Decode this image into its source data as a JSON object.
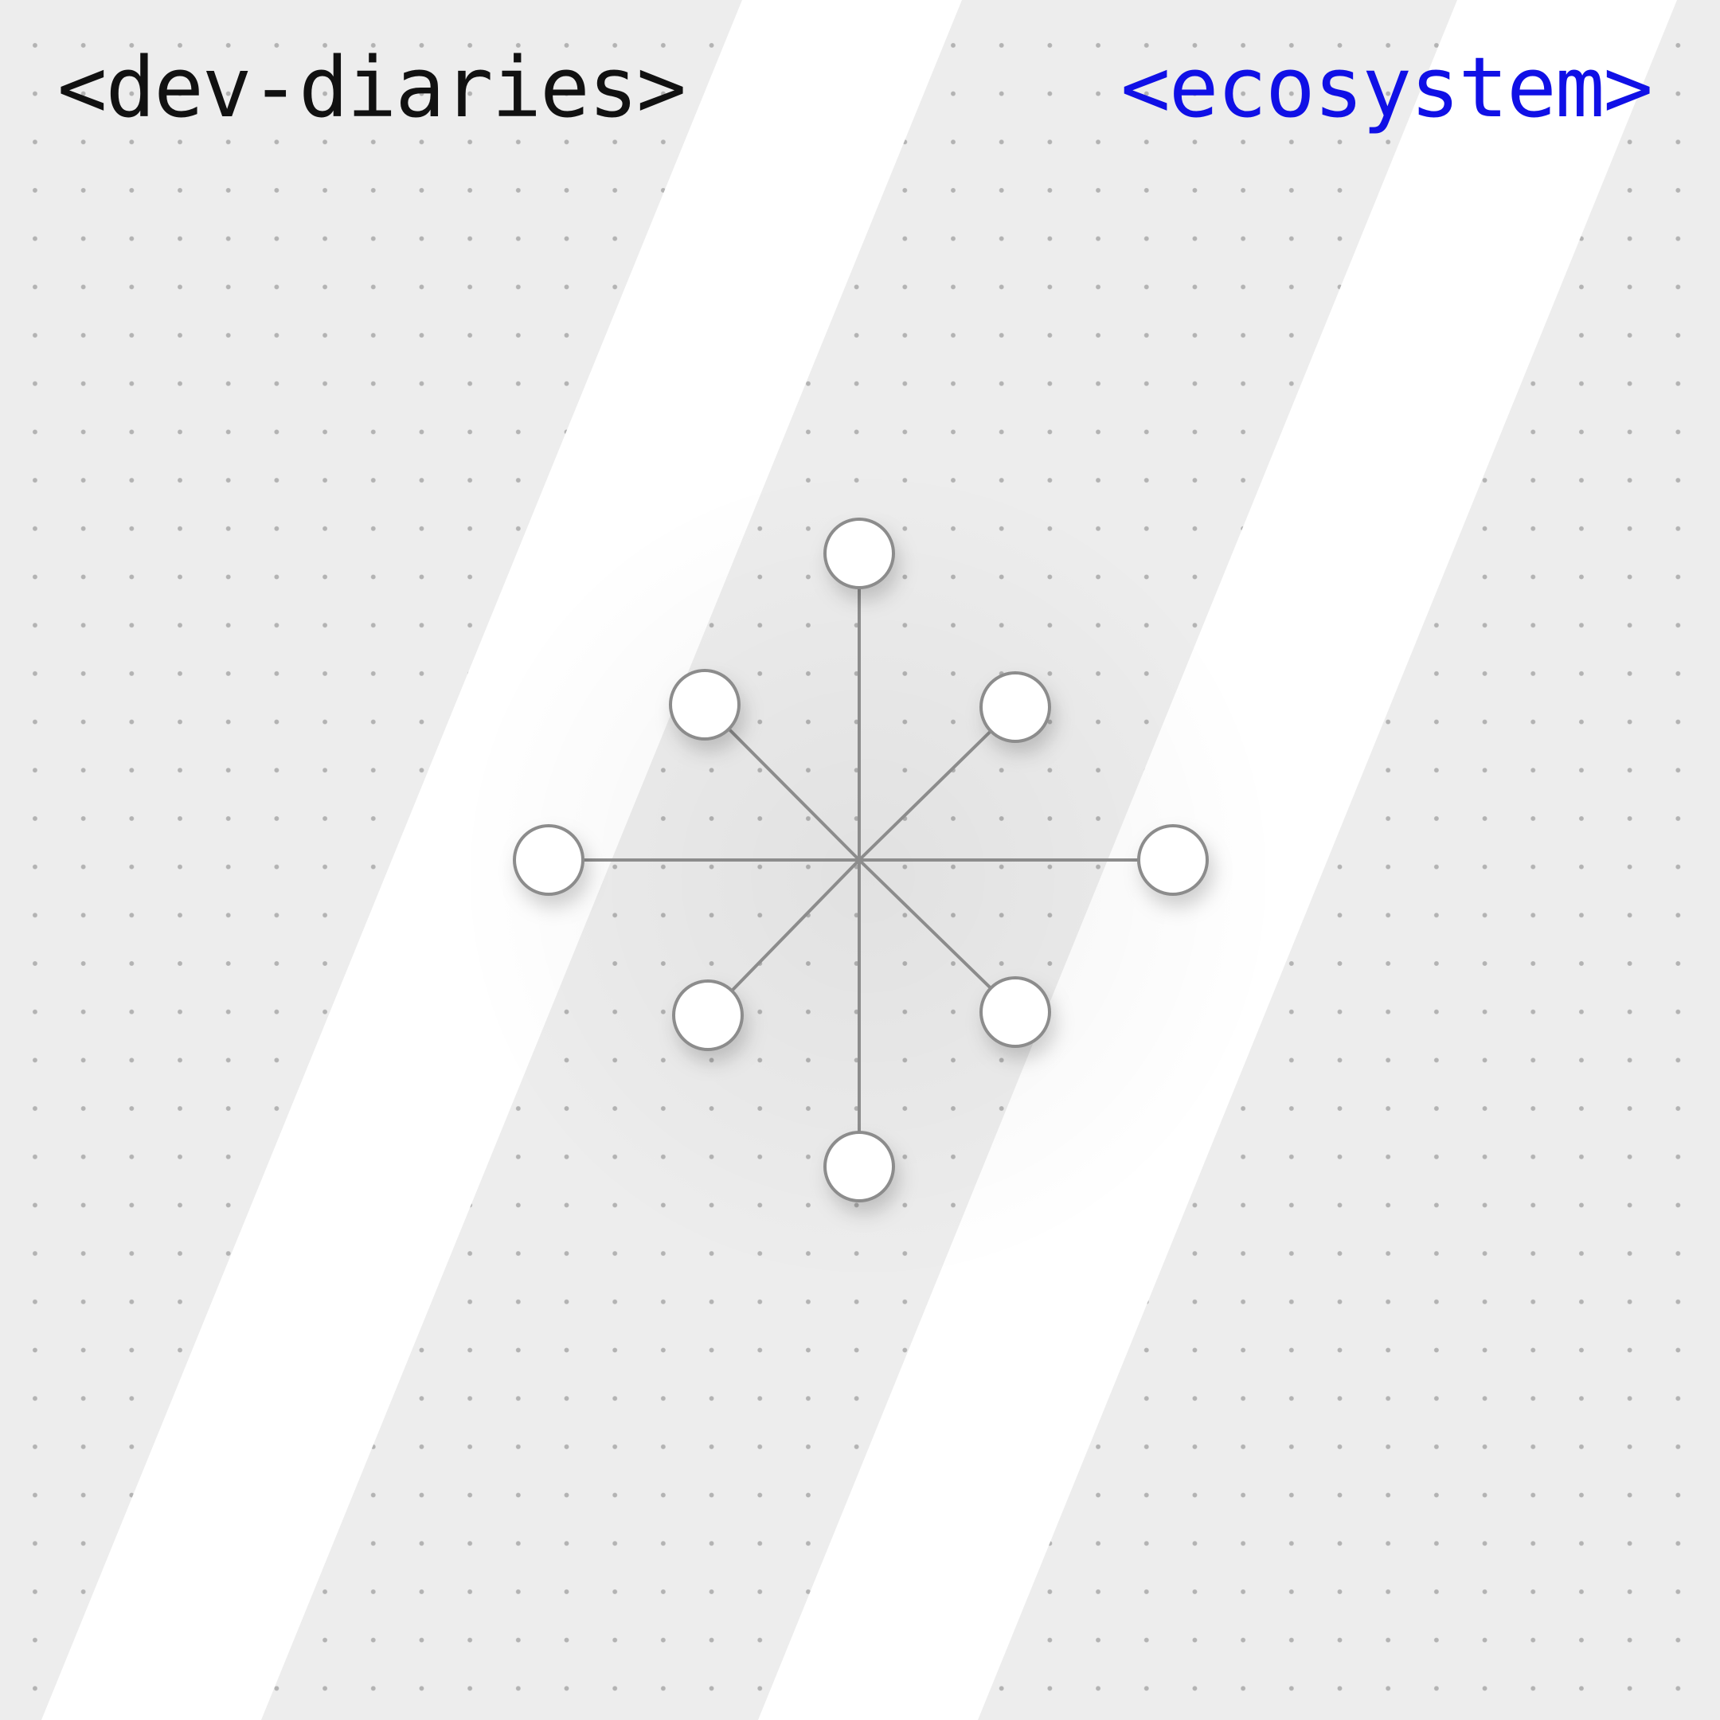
{
  "header": {
    "left_tag": "<dev-diaries>",
    "right_tag": "<ecosystem>"
  },
  "colors": {
    "background": "#ededed",
    "dot": "#b3b3b3",
    "stripe": "#ffffff",
    "left_tag_text": "#111111",
    "right_tag_text": "#1010e6",
    "node_stroke": "#8c8c8c",
    "node_fill": "#ffffff"
  },
  "icons": {
    "center": "hub-spoke-network-icon"
  }
}
